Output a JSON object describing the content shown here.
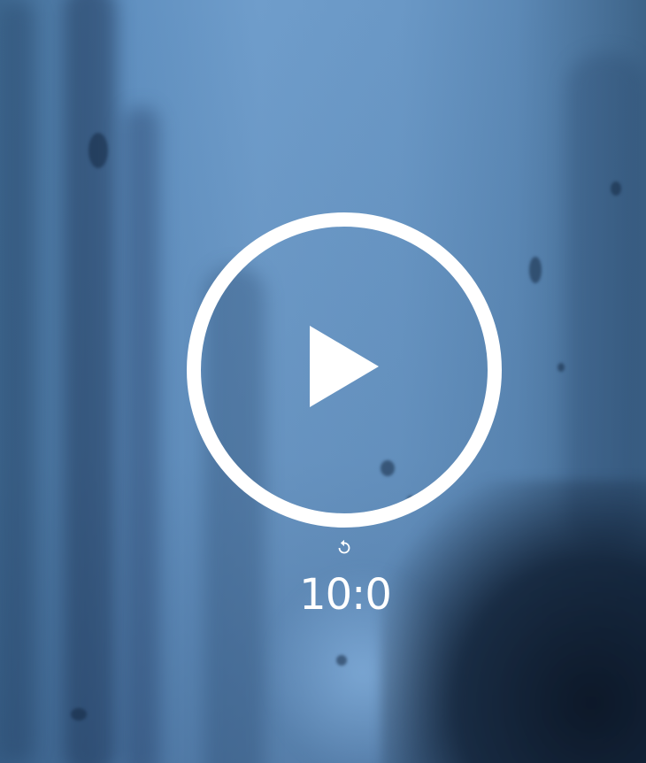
{
  "player": {
    "play_icon": "play-icon",
    "replay_icon": "replay-icon",
    "timer_text": "10:0"
  },
  "colors": {
    "control_color": "#ffffff",
    "background_tint": "#5a86b3"
  }
}
